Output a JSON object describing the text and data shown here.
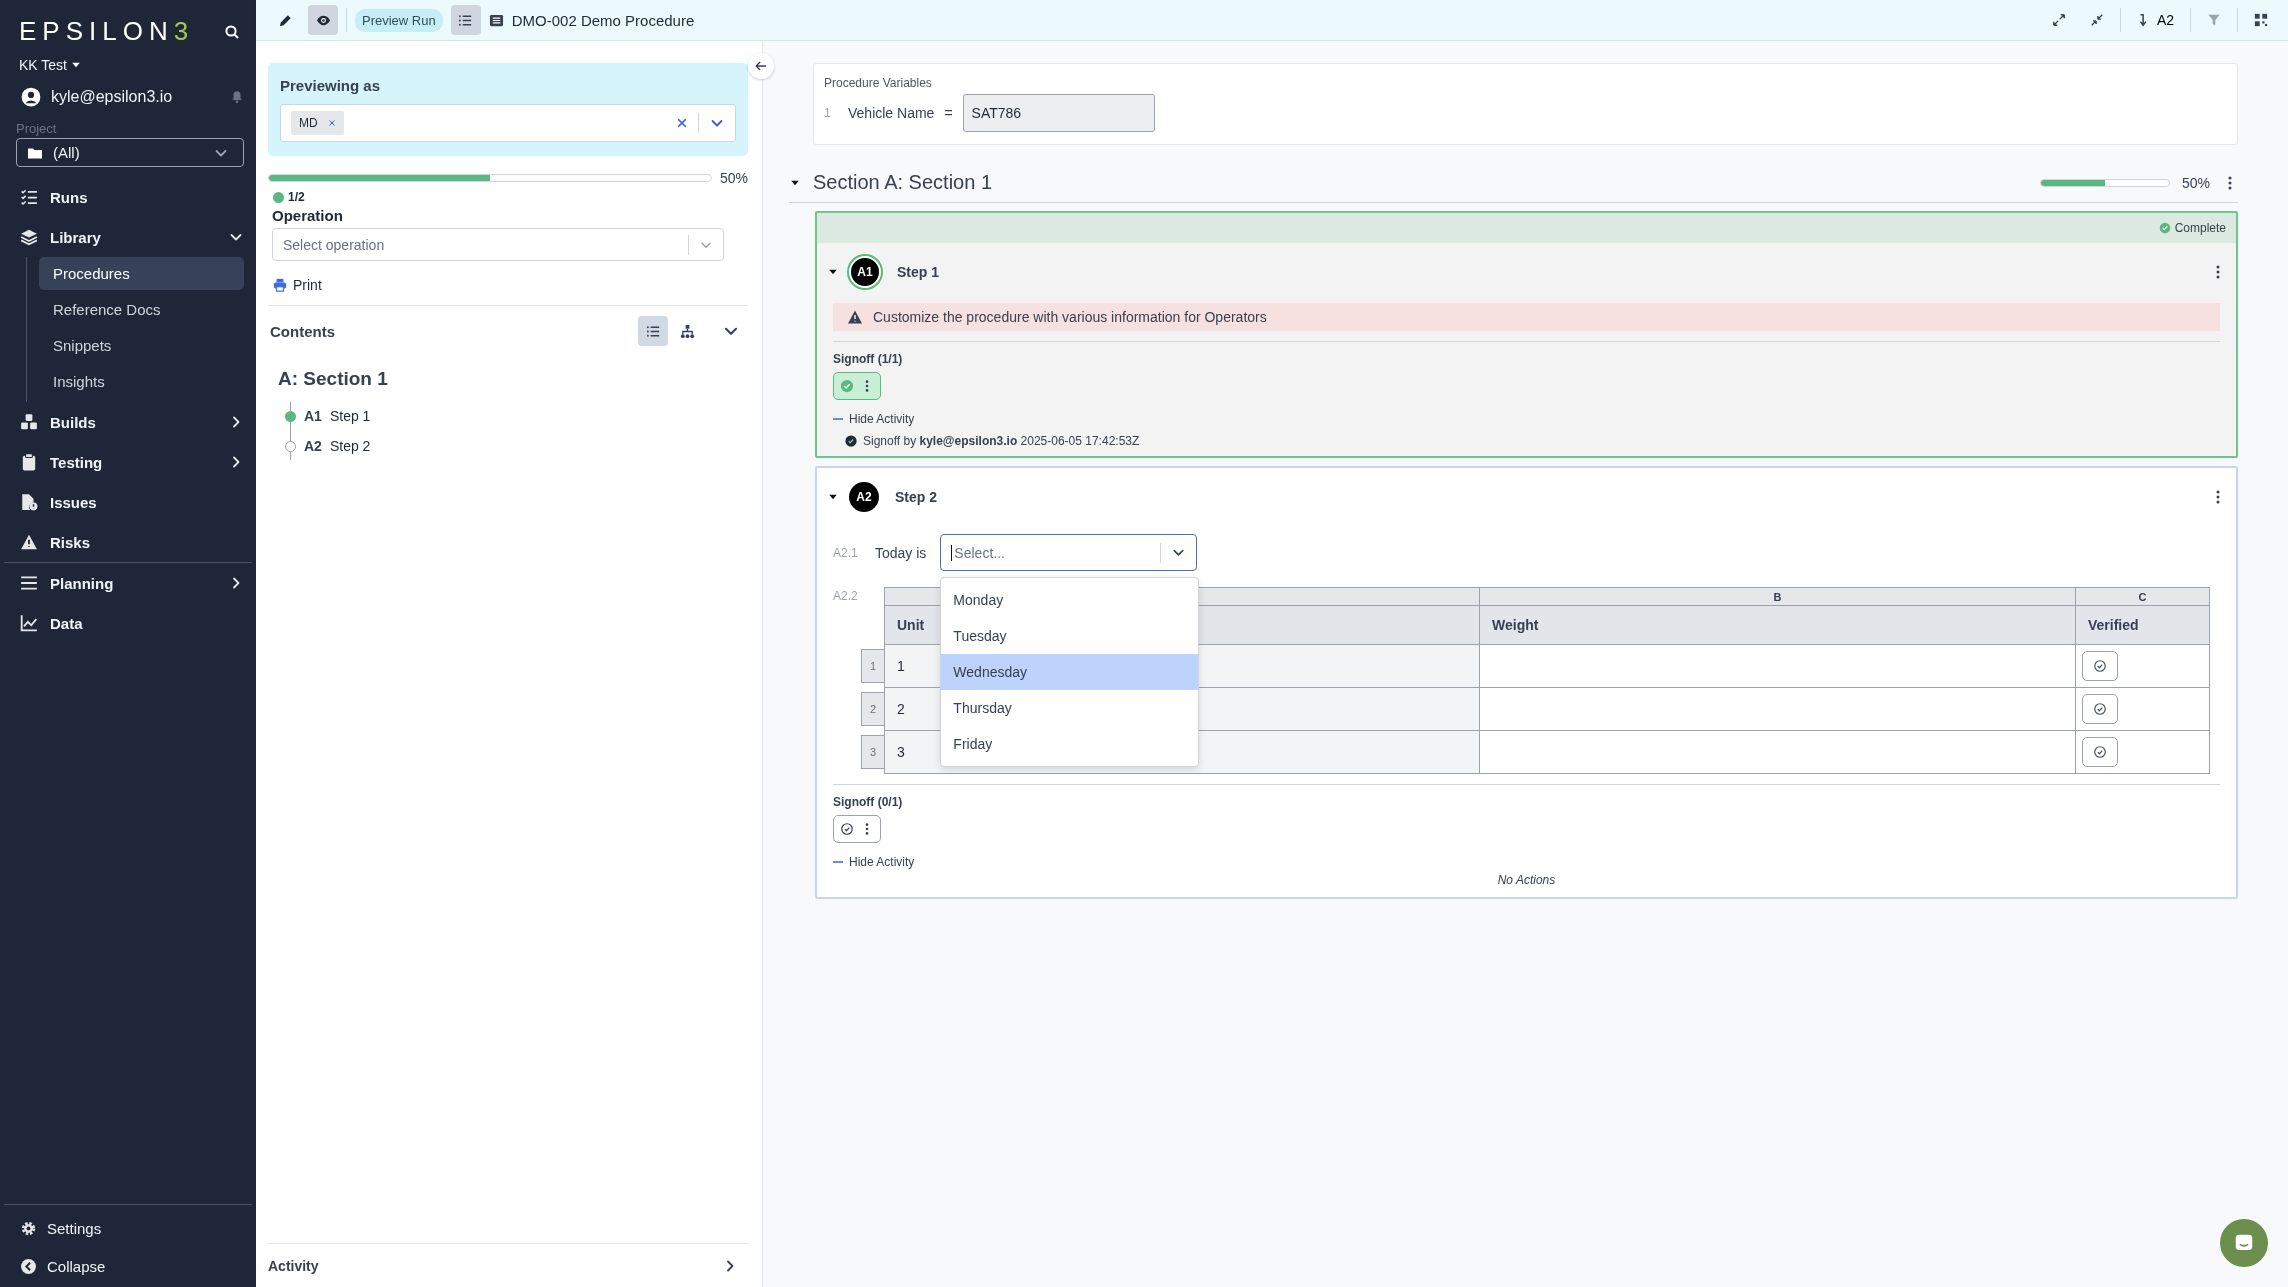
{
  "sidebar": {
    "logo": {
      "text": "EPSILON",
      "accent": "3"
    },
    "workspace": "KK Test",
    "user": "kyle@epsilon3.io",
    "project": {
      "label": "Project",
      "value": "(All)"
    },
    "groups": [
      {
        "items": [
          {
            "label": "Runs"
          },
          {
            "label": "Library",
            "expanded": true,
            "children": [
              {
                "label": "Procedures",
                "selected": true
              },
              {
                "label": "Reference Docs",
                "selected": false
              },
              {
                "label": "Snippets",
                "selected": false
              },
              {
                "label": "Insights",
                "selected": false
              }
            ]
          },
          {
            "label": "Builds",
            "expanded": false
          },
          {
            "label": "Testing",
            "expanded": false
          },
          {
            "label": "Issues"
          },
          {
            "label": "Risks"
          }
        ]
      },
      {
        "items": [
          {
            "label": "Planning",
            "expanded": false
          },
          {
            "label": "Data"
          }
        ]
      }
    ],
    "footer": [
      "Settings",
      "Collapse"
    ]
  },
  "toolbar": {
    "modes": [
      {
        "selected": false
      },
      {
        "selected": true
      }
    ],
    "badge": "Preview Run",
    "outline_selected": true,
    "title": "DMO-002 Demo Procedure",
    "jump": "A2"
  },
  "left_panel": {
    "previewing_as": {
      "label": "Previewing as",
      "tags": [
        "MD"
      ]
    },
    "progress": {
      "level": 0.5,
      "reading": "50%",
      "count": "1/2"
    },
    "operation": {
      "label": "Operation",
      "placeholder": "Select operation"
    },
    "print": "Print",
    "contents": {
      "heading": "Contents",
      "views": [
        {
          "selected": true
        },
        {
          "selected": false
        }
      ],
      "section": "A: Section 1",
      "steps": [
        {
          "number": "A1",
          "title": "Step 1",
          "complete": true
        },
        {
          "number": "A2",
          "title": "Step 2",
          "complete": false
        }
      ]
    },
    "activity": "Activity"
  },
  "main": {
    "variables": {
      "heading": "Procedure Variables",
      "rows": [
        {
          "index": "1",
          "name": "Vehicle Name",
          "operator": "=",
          "value": "SAT786"
        }
      ]
    },
    "section": {
      "title": "Section A: Section 1",
      "expanded": true,
      "level": 0.5,
      "reading": "50%",
      "steps": [
        {
          "badge": "A1",
          "title": "Step 1",
          "complete": true,
          "status": "Complete",
          "expanded": true,
          "blocks": [
            {
              "kind": "warning",
              "text": "Customize the procedure with various information for Operators"
            }
          ],
          "signoff": {
            "label": "Signoff (1/1)",
            "signed": true
          },
          "activity_toggle": "Hide Activity",
          "activity": [
            "Signoff by **kyle@epsilon3.io** 2025-06-05 17:42:53Z"
          ]
        },
        {
          "badge": "A2",
          "title": "Step 2",
          "complete": false,
          "expanded": true,
          "blocks": [
            {
              "kind": "select",
              "number": "A2.1",
              "label": "Today is",
              "placeholder": "Select...",
              "open": true,
              "options": [
                {
                  "label": "Monday",
                  "selected": false
                },
                {
                  "label": "Tuesday",
                  "selected": false
                },
                {
                  "label": "Wednesday",
                  "selected": true
                },
                {
                  "label": "Thursday",
                  "selected": false
                },
                {
                  "label": "Friday",
                  "selected": false
                }
              ]
            },
            {
              "kind": "table",
              "number": "A2.2",
              "columns": [
                {
                  "name": "Unit"
                },
                {
                  "letter": "B",
                  "name": "Weight"
                },
                {
                  "letter": "C",
                  "name": "Verified"
                }
              ],
              "rows": [
                {
                  "index": "1",
                  "unit": "1",
                  "verified": false
                },
                {
                  "index": "2",
                  "unit": "2",
                  "verified": false
                },
                {
                  "index": "3",
                  "unit": "3",
                  "verified": false
                }
              ]
            }
          ],
          "signoff": {
            "label": "Signoff (0/1)",
            "signed": false
          },
          "activity_toggle": "Hide Activity",
          "no_activity": "No Actions"
        }
      ]
    }
  }
}
